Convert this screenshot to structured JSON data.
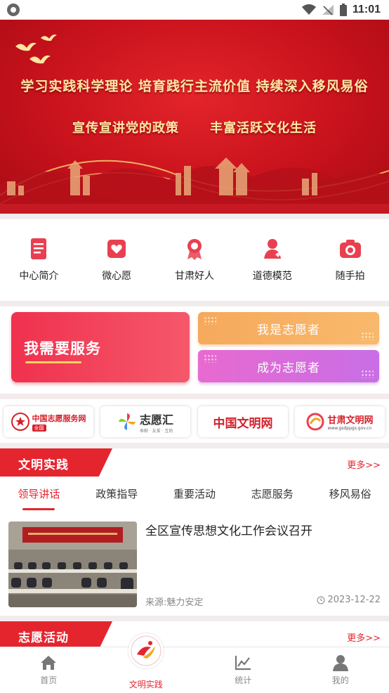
{
  "status_bar": {
    "time": "11:01"
  },
  "banner": {
    "line1": "学习实践科学理论  培育践行主流价值  持续深入移风易俗",
    "line2_a": "宣传宣讲党的政策",
    "line2_b": "丰富活跃文化生活"
  },
  "menu": {
    "items": [
      {
        "label": "中心简介",
        "icon": "document-icon"
      },
      {
        "label": "微心愿",
        "icon": "heart-gift-icon"
      },
      {
        "label": "甘肃好人",
        "icon": "award-icon"
      },
      {
        "label": "道德模范",
        "icon": "person-icon"
      },
      {
        "label": "随手拍",
        "icon": "camera-icon"
      }
    ]
  },
  "services": {
    "need_service": "我需要服务",
    "i_am_volunteer": "我是志愿者",
    "become_volunteer": "成为志愿者"
  },
  "partners": {
    "items": [
      {
        "name": "中国志愿服务网",
        "sub": "全国"
      },
      {
        "name": "志愿汇",
        "sub": "奉献 · 友爱 · 互助"
      },
      {
        "name": "中国文明网",
        "sub": ""
      },
      {
        "name": "甘肃文明网",
        "sub": "www.gsdppgs.gov.cn"
      }
    ]
  },
  "section_practice": {
    "title": "文明实践",
    "more": "更多>>",
    "tabs": [
      "领导讲话",
      "政策指导",
      "重要活动",
      "志愿服务",
      "移风易俗"
    ],
    "active_tab": 0,
    "news": [
      {
        "title": "全区宣传思想文化工作会议召开",
        "source": "来源:魅力安定",
        "date": "2023-12-22"
      }
    ]
  },
  "section_volunteer": {
    "title": "志愿活动",
    "more": "更多>>"
  },
  "bottom_nav": {
    "items": [
      {
        "label": "首页",
        "icon": "home-icon"
      },
      {
        "label": "文明实践",
        "icon": "civilization-logo-icon"
      },
      {
        "label": "统计",
        "icon": "chart-icon"
      },
      {
        "label": "我的",
        "icon": "profile-icon"
      }
    ],
    "active": 1
  },
  "colors": {
    "primary": "#e5252e",
    "orange": "#f6a95c",
    "purple": "#d06cdc"
  }
}
